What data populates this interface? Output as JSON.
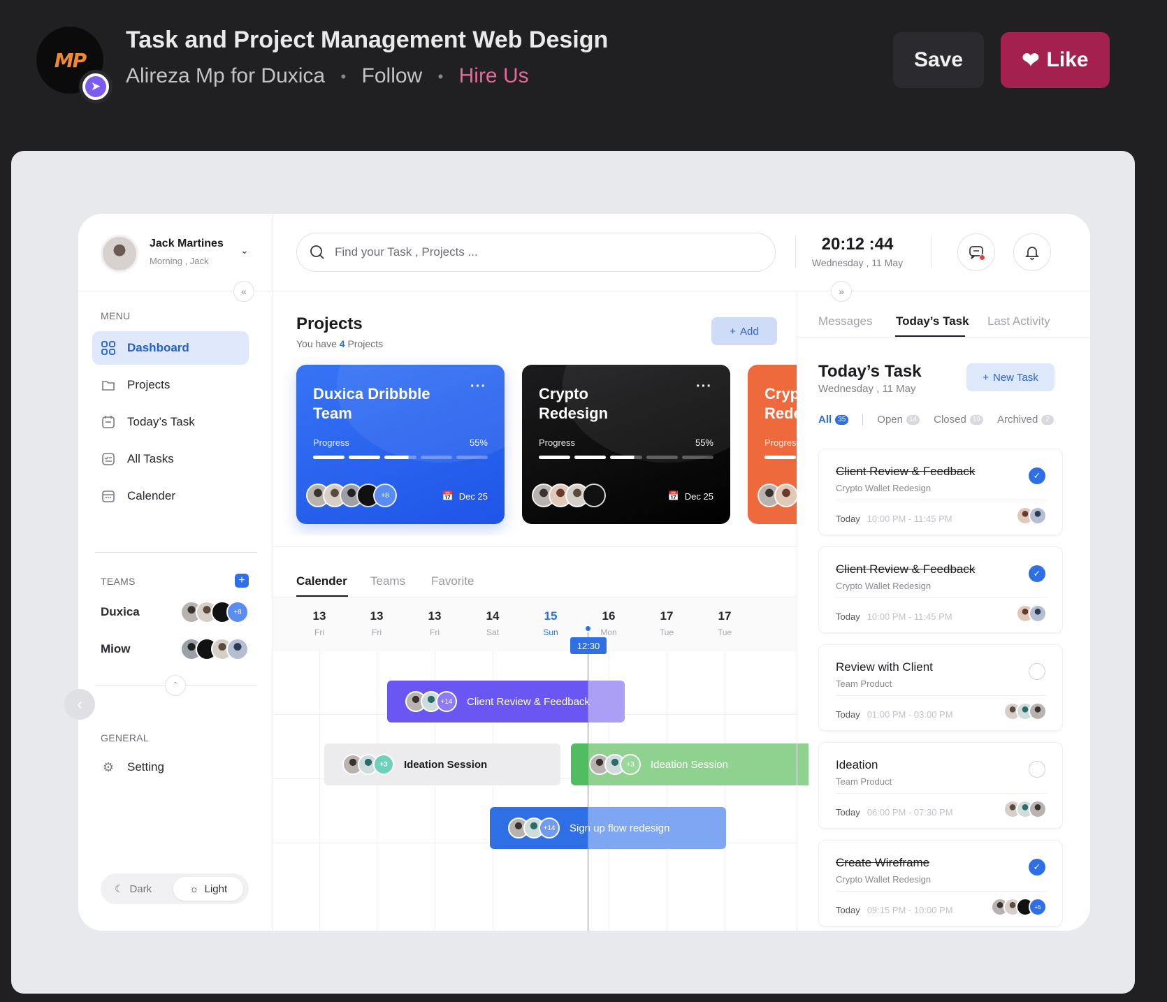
{
  "header": {
    "logo_text": "MP",
    "title": "Task and Project Management Web Design",
    "author": "Alireza Mp",
    "for_word": "for",
    "team": "Duxica",
    "follow": "Follow",
    "hire": "Hire Us",
    "save": "Save",
    "like": "Like"
  },
  "sidebar": {
    "user_name": "Jack Martines",
    "user_greeting": "Morning , Jack",
    "menu_label": "MENU",
    "menu": [
      {
        "label": "Dashboard",
        "icon": "grid-icon"
      },
      {
        "label": "Projects",
        "icon": "folder-icon"
      },
      {
        "label": "Today’s Task",
        "icon": "calendar-task-icon"
      },
      {
        "label": "All Tasks",
        "icon": "checklist-icon"
      },
      {
        "label": "Calender",
        "icon": "calendar-icon"
      }
    ],
    "teams_label": "TEAMS",
    "teams": [
      {
        "name": "Duxica",
        "extra": "+8"
      },
      {
        "name": "Miow"
      }
    ],
    "general_label": "GENERAL",
    "setting": "Setting",
    "theme_dark": "Dark",
    "theme_light": "Light"
  },
  "topbar": {
    "search_placeholder": "Find your Task , Projects ...",
    "time": "20:12 :44",
    "date": "Wednesday , 11 May"
  },
  "projects": {
    "title": "Projects",
    "subtitle_prefix": "You have",
    "count": "4",
    "subtitle_suffix": "Projects",
    "add": "Add",
    "cards": [
      {
        "name": "Duxica Dribbble Team",
        "progress_label": "Progress",
        "progress_text": "55%",
        "progress": 0.55,
        "extra": "+8",
        "due": "Dec 25"
      },
      {
        "name": "Crypto Redesign",
        "progress_label": "Progress",
        "progress_text": "55%",
        "progress": 0.55,
        "due": "Dec 25"
      },
      {
        "name": "Crypto Redesign",
        "progress_label": "Progress"
      }
    ]
  },
  "calendar": {
    "tabs": [
      "Calender",
      "Teams",
      "Favorite"
    ],
    "days": [
      {
        "num": "13",
        "wd": "Fri"
      },
      {
        "num": "13",
        "wd": "Fri"
      },
      {
        "num": "13",
        "wd": "Fri"
      },
      {
        "num": "14",
        "wd": "Sat"
      },
      {
        "num": "15",
        "wd": "Sun"
      },
      {
        "num": "16",
        "wd": "Mon"
      },
      {
        "num": "17",
        "wd": "Tue"
      },
      {
        "num": "17",
        "wd": "Tue"
      }
    ],
    "now_label": "12:30",
    "events": [
      {
        "title": "Client Review & Feedback",
        "extra": "+14"
      },
      {
        "title": "Ideation Session",
        "extra": "+3"
      },
      {
        "title": "Ideation Session",
        "extra": "+3"
      },
      {
        "title": "Sign up flow redesign",
        "extra": "+14"
      }
    ]
  },
  "right": {
    "tabs": [
      "Messages",
      "Today’s Task",
      "Last Activity"
    ],
    "title": "Today’s Task",
    "date": "Wednesday , 11 May",
    "new_task": "New Task",
    "filters": [
      {
        "label": "All",
        "count": "35"
      },
      {
        "label": "Open",
        "count": "14"
      },
      {
        "label": "Closed",
        "count": "19"
      },
      {
        "label": "Archived",
        "count": "2"
      }
    ],
    "tasks": [
      {
        "title": "Client Review & Feedback",
        "sub": "Crypto Wallet Redesign",
        "day": "Today",
        "time": "10:00 PM - 11:45 PM",
        "done": true
      },
      {
        "title": "Client Review & Feedback",
        "sub": "Crypto Wallet Redesign",
        "day": "Today",
        "time": "10:00 PM - 11:45 PM",
        "done": true
      },
      {
        "title": "Review with Client",
        "sub": "Team Product",
        "day": "Today",
        "time": "01:00 PM - 03:00 PM",
        "done": false
      },
      {
        "title": "Ideation",
        "sub": "Team Product",
        "day": "Today",
        "time": "06:00 PM - 07:30 PM",
        "done": false
      },
      {
        "title": "Create Wireframe",
        "sub": "Crypto Wallet Redesign",
        "day": "Today",
        "time": "09:15 PM - 10:00 PM",
        "done": true,
        "extra": "+5"
      }
    ]
  },
  "colors": {
    "accent": "#2f6fe6",
    "like": "#a3204f",
    "hire": "#e8669a"
  }
}
